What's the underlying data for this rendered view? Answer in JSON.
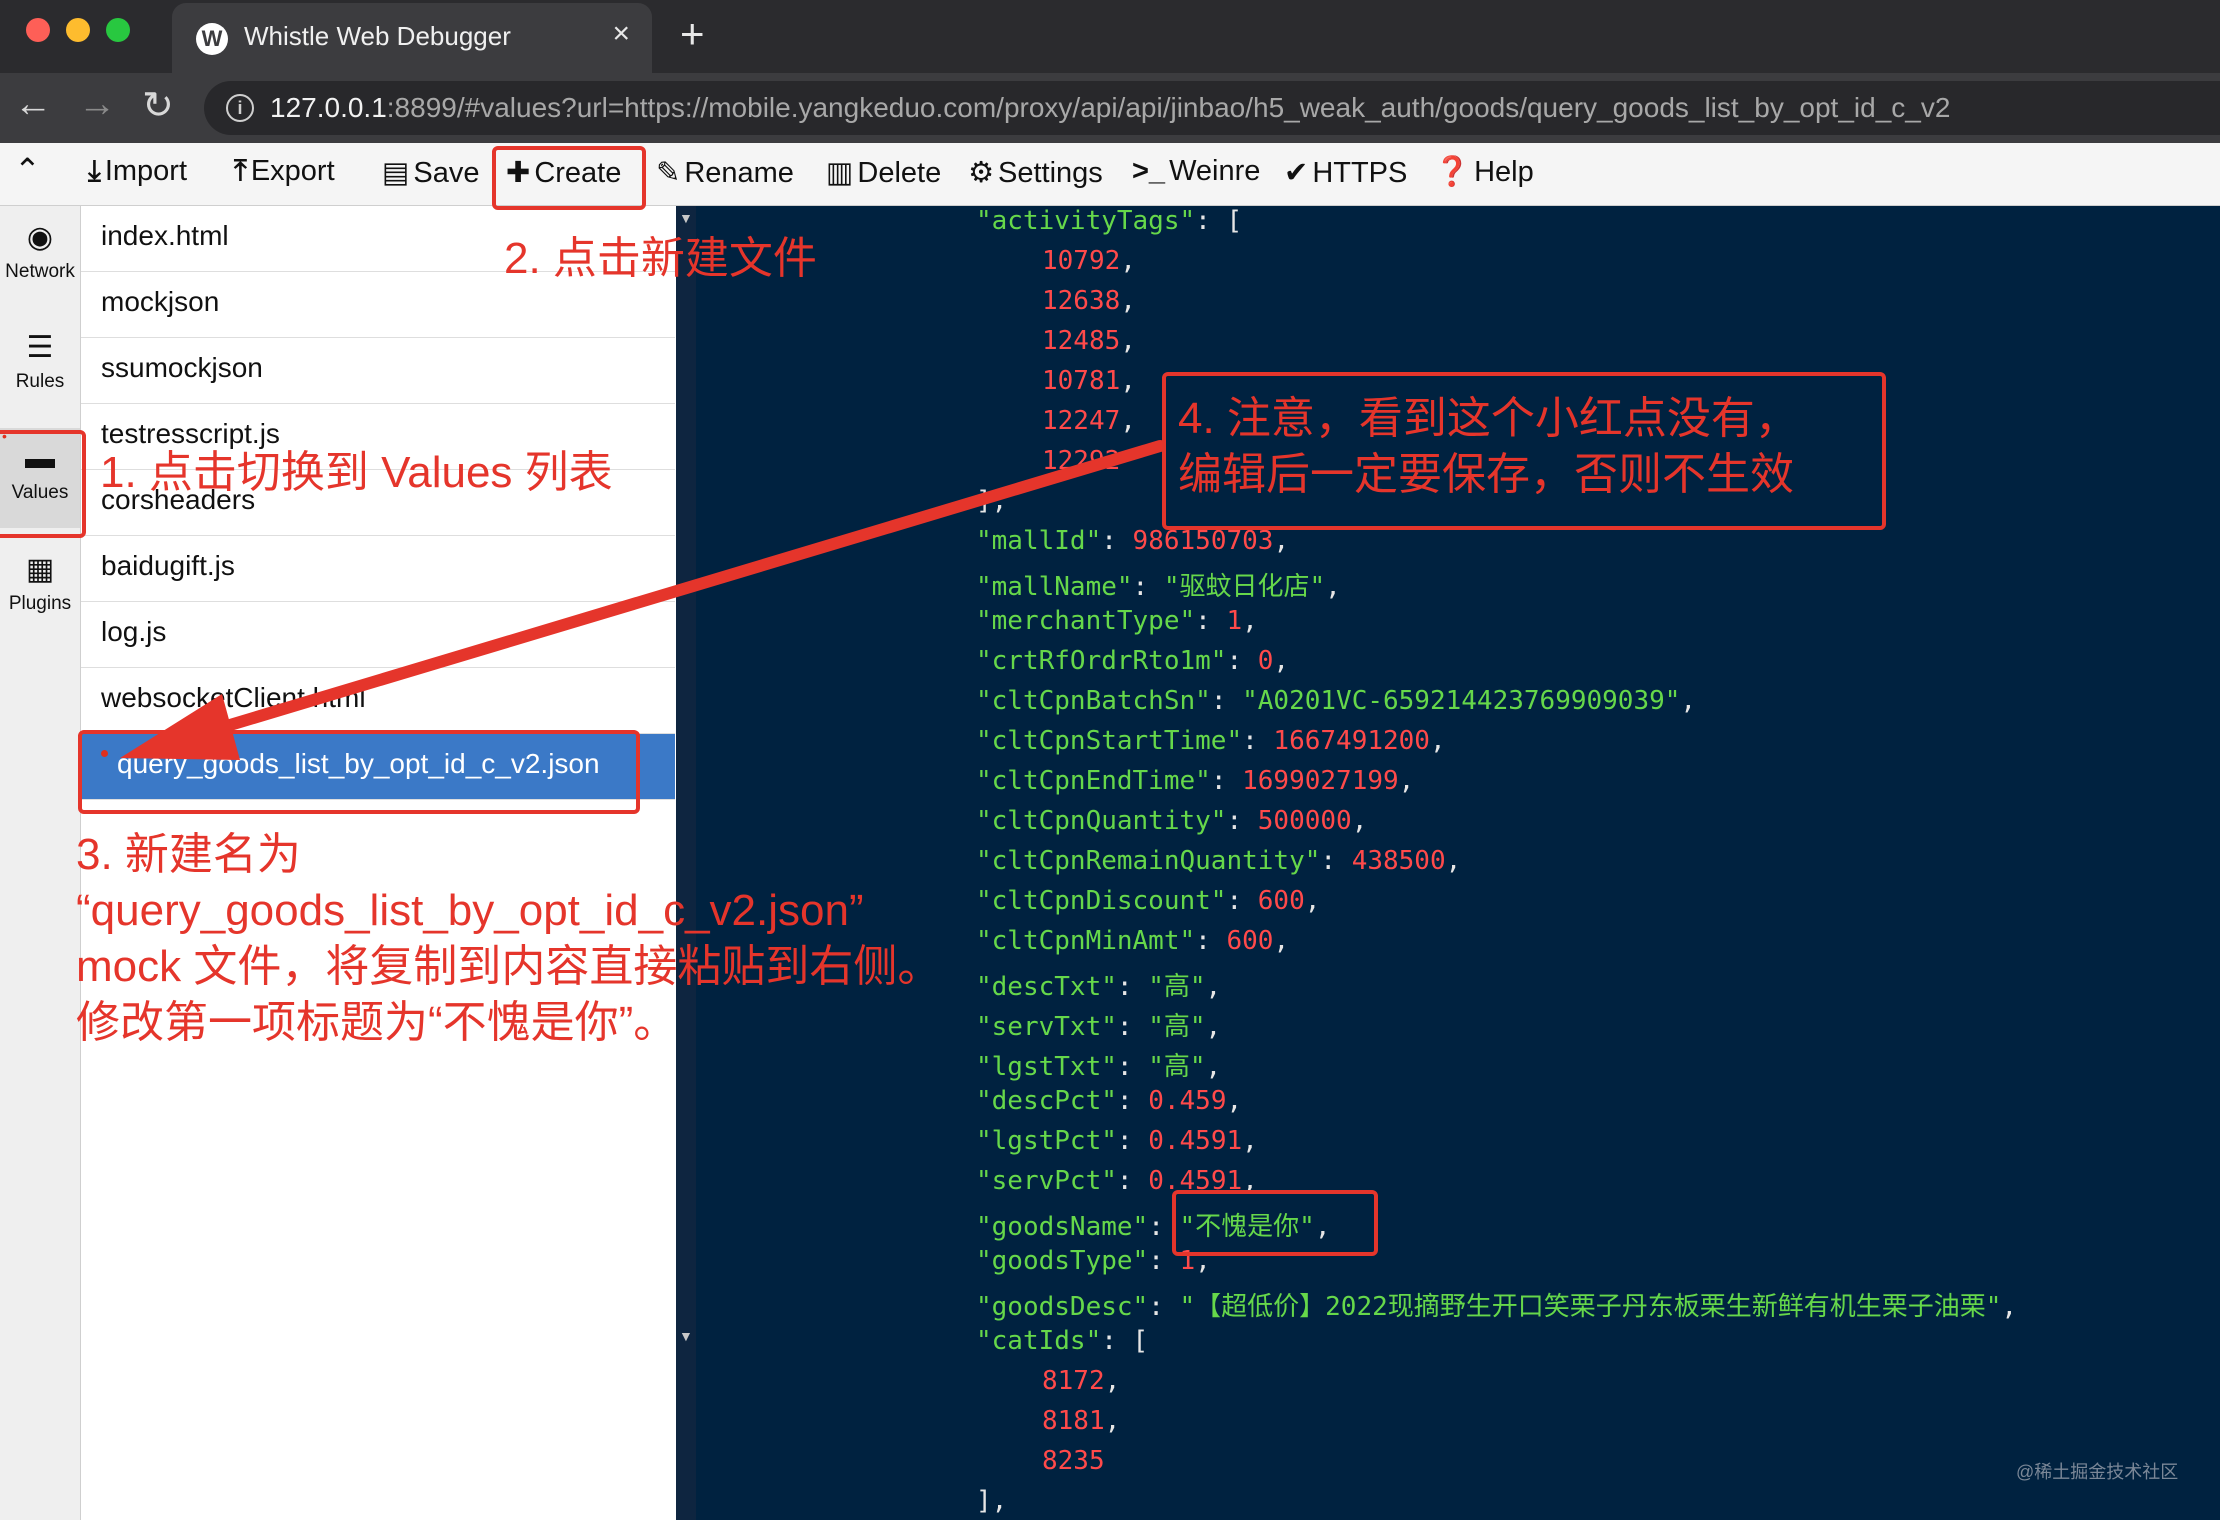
{
  "browser": {
    "tab_title": "Whistle Web Debugger",
    "tab_close": "×",
    "new_tab": "+",
    "url_host": "127.0.0.1",
    "url_rest": ":8899/#values?url=https://mobile.yangkeduo.com/proxy/api/api/jinbao/h5_weak_auth/goods/query_goods_list_by_opt_id_c_v2"
  },
  "toolbar": {
    "import": "Import",
    "export": "Export",
    "save": "Save",
    "create": "Create",
    "rename": "Rename",
    "delete": "Delete",
    "settings": "Settings",
    "weinre": "Weinre",
    "https": "HTTPS",
    "help": "Help"
  },
  "sidebar": {
    "network": "Network",
    "rules": "Rules",
    "values": "Values",
    "plugins": "Plugins"
  },
  "files": [
    "index.html",
    "mockjson",
    "ssumockjson",
    "testresscript.js",
    "corsheaders",
    "baidugift.js",
    "log.js",
    "websocketClient.html",
    "query_goods_list_by_opt_id_c_v2.json"
  ],
  "code": {
    "l0k": "\"activityTags\"",
    "l0p": ": [",
    "l1": "10792",
    "l2": "12638",
    "l3": "12485",
    "l4": "10781",
    "l5": "12247",
    "l6": "12292",
    "l7": "],",
    "l8k": "\"mallId\"",
    "l8v": "986150703",
    "l9k": "\"mallName\"",
    "l9v": "\"驱蚊日化店\"",
    "l10k": "\"merchantType\"",
    "l10v": "1",
    "l11k": "\"crtRfOrdrRto1m\"",
    "l11v": "0",
    "l12k": "\"cltCpnBatchSn\"",
    "l12v": "\"A0201VC-659214423769909039\"",
    "l13k": "\"cltCpnStartTime\"",
    "l13v": "1667491200",
    "l14k": "\"cltCpnEndTime\"",
    "l14v": "1699027199",
    "l15k": "\"cltCpnQuantity\"",
    "l15v": "500000",
    "l16k": "\"cltCpnRemainQuantity\"",
    "l16v": "438500",
    "l17k": "\"cltCpnDiscount\"",
    "l17v": "600",
    "l18k": "\"cltCpnMinAmt\"",
    "l18v": "600",
    "l19k": "\"descTxt\"",
    "l19v": "\"高\"",
    "l20k": "\"servTxt\"",
    "l20v": "\"高\"",
    "l21k": "\"lgstTxt\"",
    "l21v": "\"高\"",
    "l22k": "\"descPct\"",
    "l22v": "0.459",
    "l23k": "\"lgstPct\"",
    "l23v": "0.4591",
    "l24k": "\"servPct\"",
    "l24v": "0.4591",
    "l25k": "\"goodsName\"",
    "l25v": "\"不愧是你\"",
    "l26k": "\"goodsType\"",
    "l26v": "1",
    "l27k": "\"goodsDesc\"",
    "l27v": "\"【超低价】2022现摘野生开口笑栗子丹东板栗生新鲜有机生栗子油栗\"",
    "l28k": "\"catIds\"",
    "l28p": ": [",
    "l29": "8172",
    "l30": "8181",
    "l31": "8235",
    "l32": "],"
  },
  "watermark": "@稀土掘金技术社区",
  "annotations": {
    "a1": "1. 点击切换到 Values 列表",
    "a2": "2. 点击新建文件",
    "a3_1": "3. 新建名为",
    "a3_2": "“query_goods_list_by_opt_id_c_v2.json”",
    "a3_3": "mock 文件，将复制到内容直接粘贴到右侧。",
    "a3_4": "修改第一项标题为“不愧是你”。",
    "a4_1": "4. 注意，看到这个小红点没有，",
    "a4_2": "编辑后一定要保存，否则不生效"
  },
  "colors": {
    "editor_bg": "#002240",
    "key": "#66d84a",
    "number": "#ff4a4a",
    "annotation": "#e5352b",
    "selected_file": "#3b79c7"
  }
}
